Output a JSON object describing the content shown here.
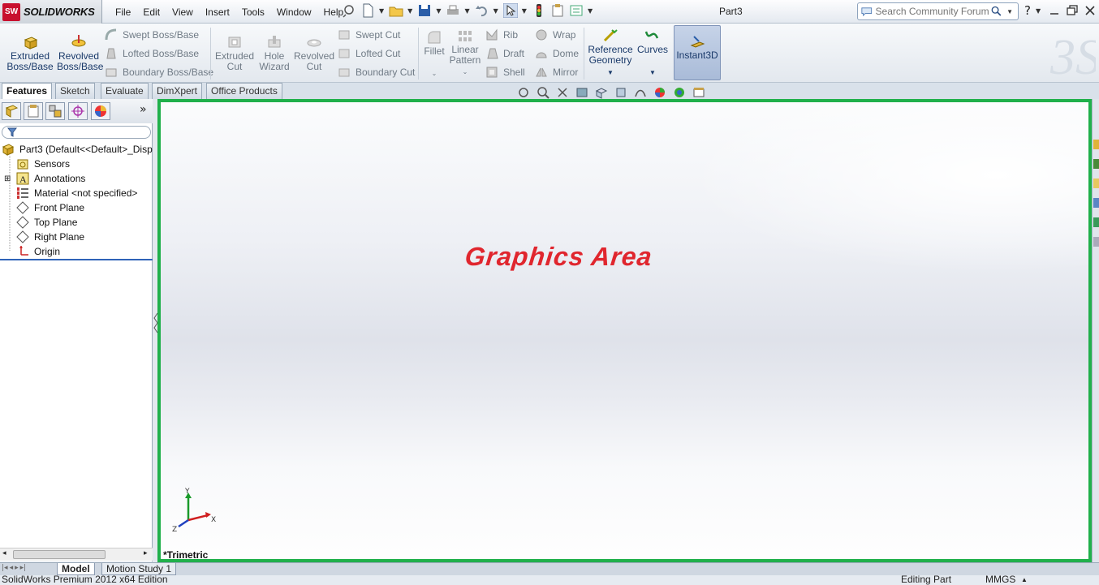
{
  "app": {
    "logo_text": "SOLIDWORKS",
    "logo_badge": "SW",
    "document_title": "Part3"
  },
  "menu": [
    "File",
    "Edit",
    "View",
    "Insert",
    "Tools",
    "Window",
    "Help"
  ],
  "search": {
    "placeholder": "Search Community Forum"
  },
  "commands": {
    "extruded_boss": "Extruded Boss/Base",
    "revolved_boss": "Revolved Boss/Base",
    "swept_boss": "Swept Boss/Base",
    "lofted_boss": "Lofted Boss/Base",
    "boundary_boss": "Boundary Boss/Base",
    "extruded_cut": "Extruded Cut",
    "hole_wizard": "Hole Wizard",
    "revolved_cut": "Revolved Cut",
    "swept_cut": "Swept Cut",
    "lofted_cut": "Lofted Cut",
    "boundary_cut": "Boundary Cut",
    "fillet": "Fillet",
    "linear_pattern": "Linear Pattern",
    "rib": "Rib",
    "draft": "Draft",
    "shell": "Shell",
    "wrap": "Wrap",
    "dome": "Dome",
    "mirror": "Mirror",
    "reference_geometry": "Reference Geometry",
    "curves": "Curves",
    "instant3d": "Instant3D"
  },
  "tabs": [
    "Features",
    "Sketch",
    "Evaluate",
    "DimXpert",
    "Office Products"
  ],
  "tree": {
    "root": "Part3  (Default<<Default>_Disp",
    "items": [
      "Sensors",
      "Annotations",
      "Material <not specified>",
      "Front Plane",
      "Top Plane",
      "Right Plane",
      "Origin"
    ]
  },
  "graphics": {
    "label": "Graphics Area",
    "view_orientation": "*Trimetric",
    "axes": [
      "Y",
      "X",
      "Z"
    ]
  },
  "bottom_tabs": [
    "Model",
    "Motion Study 1"
  ],
  "status": {
    "edition": "SolidWorks Premium 2012 x64 Edition",
    "mode": "Editing Part",
    "units": "MMGS"
  },
  "colors": {
    "graphics_border": "#20b04b",
    "graphics_label": "#e0262e",
    "logo_red": "#c8102e"
  }
}
